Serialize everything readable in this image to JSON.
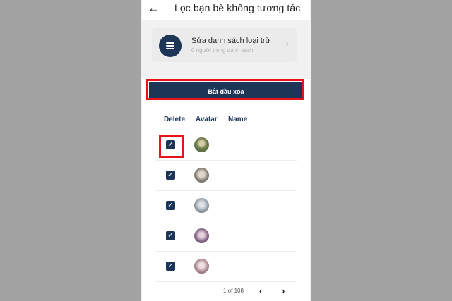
{
  "header": {
    "back_icon": "arrow-left-icon",
    "title": "Lọc bạn bè không tương tác"
  },
  "exclusion_card": {
    "icon": "menu-icon",
    "title": "Sửa danh sách loại trừ",
    "subtitle": "0 người trong danh sách",
    "chevron_icon": "chevron-right-icon"
  },
  "start_button": {
    "label": "Bắt đầu xóa"
  },
  "table": {
    "columns": [
      "Delete",
      "Avatar",
      "Name"
    ],
    "rows": [
      {
        "checked": true,
        "avatar_color": "#7c8a5a",
        "name": ""
      },
      {
        "checked": true,
        "avatar_color": "#8a8478",
        "name": ""
      },
      {
        "checked": true,
        "avatar_color": "#9aa3ad",
        "name": ""
      },
      {
        "checked": true,
        "avatar_color": "#8c6c8e",
        "name": ""
      },
      {
        "checked": true,
        "avatar_color": "#b28f95",
        "name": ""
      }
    ]
  },
  "pagination": {
    "label": "1 of 108",
    "prev_icon": "chevron-left-icon",
    "next_icon": "chevron-right-icon"
  },
  "colors": {
    "accent": "#1d3557",
    "highlight": "#e8121b"
  }
}
